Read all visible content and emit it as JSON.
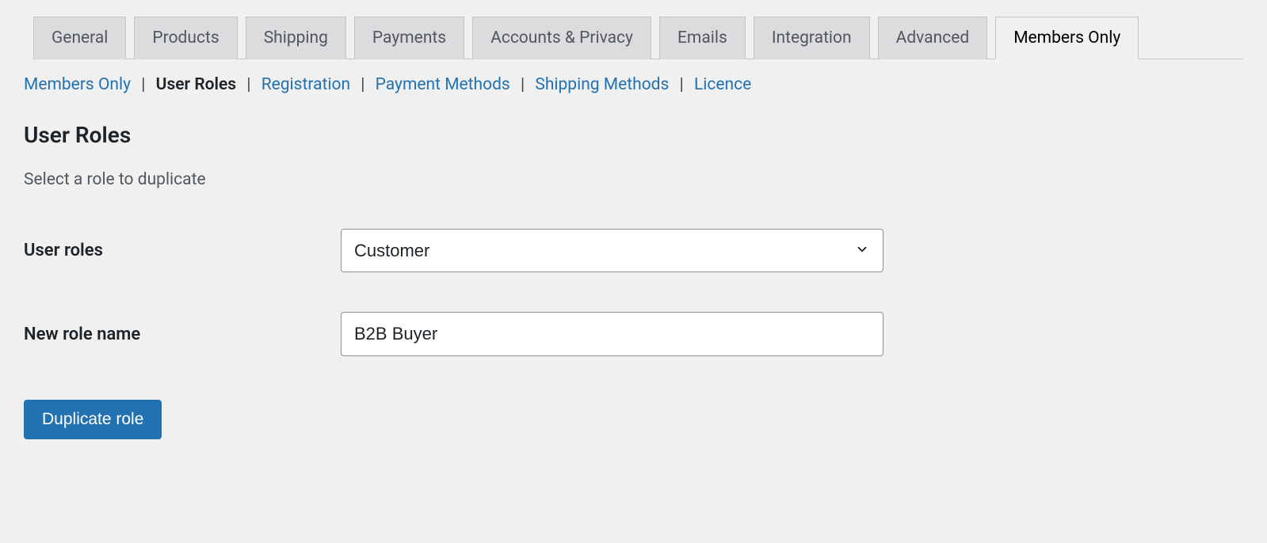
{
  "tabs": [
    {
      "label": "General",
      "active": false
    },
    {
      "label": "Products",
      "active": false
    },
    {
      "label": "Shipping",
      "active": false
    },
    {
      "label": "Payments",
      "active": false
    },
    {
      "label": "Accounts & Privacy",
      "active": false
    },
    {
      "label": "Emails",
      "active": false
    },
    {
      "label": "Integration",
      "active": false
    },
    {
      "label": "Advanced",
      "active": false
    },
    {
      "label": "Members Only",
      "active": true
    }
  ],
  "subnav": [
    {
      "label": "Members Only",
      "active": false
    },
    {
      "label": "User Roles",
      "active": true
    },
    {
      "label": "Registration",
      "active": false
    },
    {
      "label": "Payment Methods",
      "active": false
    },
    {
      "label": "Shipping Methods",
      "active": false
    },
    {
      "label": "Licence",
      "active": false
    }
  ],
  "page": {
    "title": "User Roles",
    "description": "Select a role to duplicate"
  },
  "form": {
    "user_roles_label": "User roles",
    "user_roles_value": "Customer",
    "new_role_label": "New role name",
    "new_role_value": "B2B Buyer",
    "submit_label": "Duplicate role"
  }
}
